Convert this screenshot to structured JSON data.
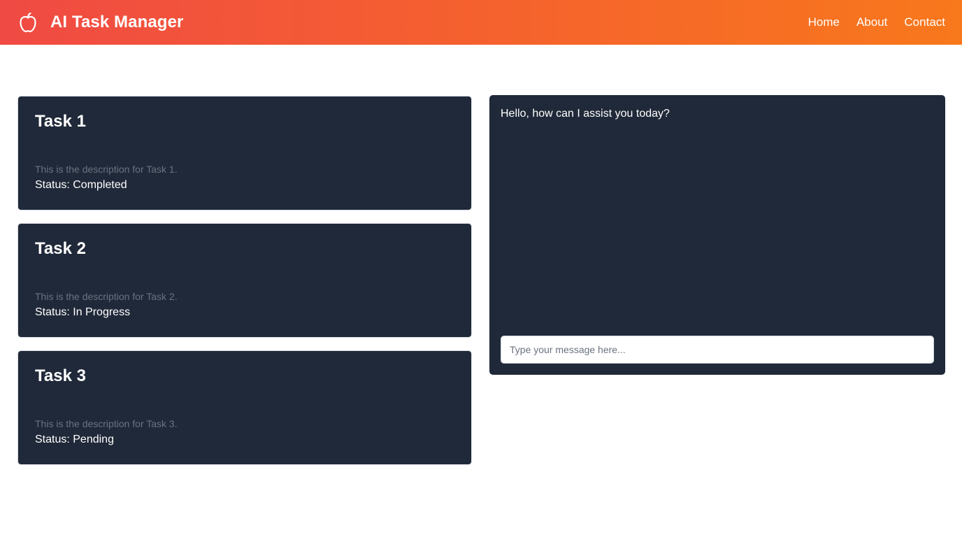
{
  "header": {
    "title": "AI Task Manager",
    "logo_icon": "apple-icon",
    "nav": [
      "Home",
      "About",
      "Contact"
    ],
    "gradient": [
      "#f04a44",
      "#f8781c"
    ]
  },
  "tasks": [
    {
      "title": "Task 1",
      "description": "This is the description for Task 1.",
      "status": "Status: Completed"
    },
    {
      "title": "Task 2",
      "description": "This is the description for Task 2.",
      "status": "Status: In Progress"
    },
    {
      "title": "Task 3",
      "description": "This is the description for Task 3.",
      "status": "Status: Pending"
    }
  ],
  "chat": {
    "message": "Hello, how can I assist you today?",
    "input_value": "",
    "input_placeholder": "Type your message here..."
  },
  "colors": {
    "card_bg": "#202939",
    "description_text": "#6b7280"
  }
}
